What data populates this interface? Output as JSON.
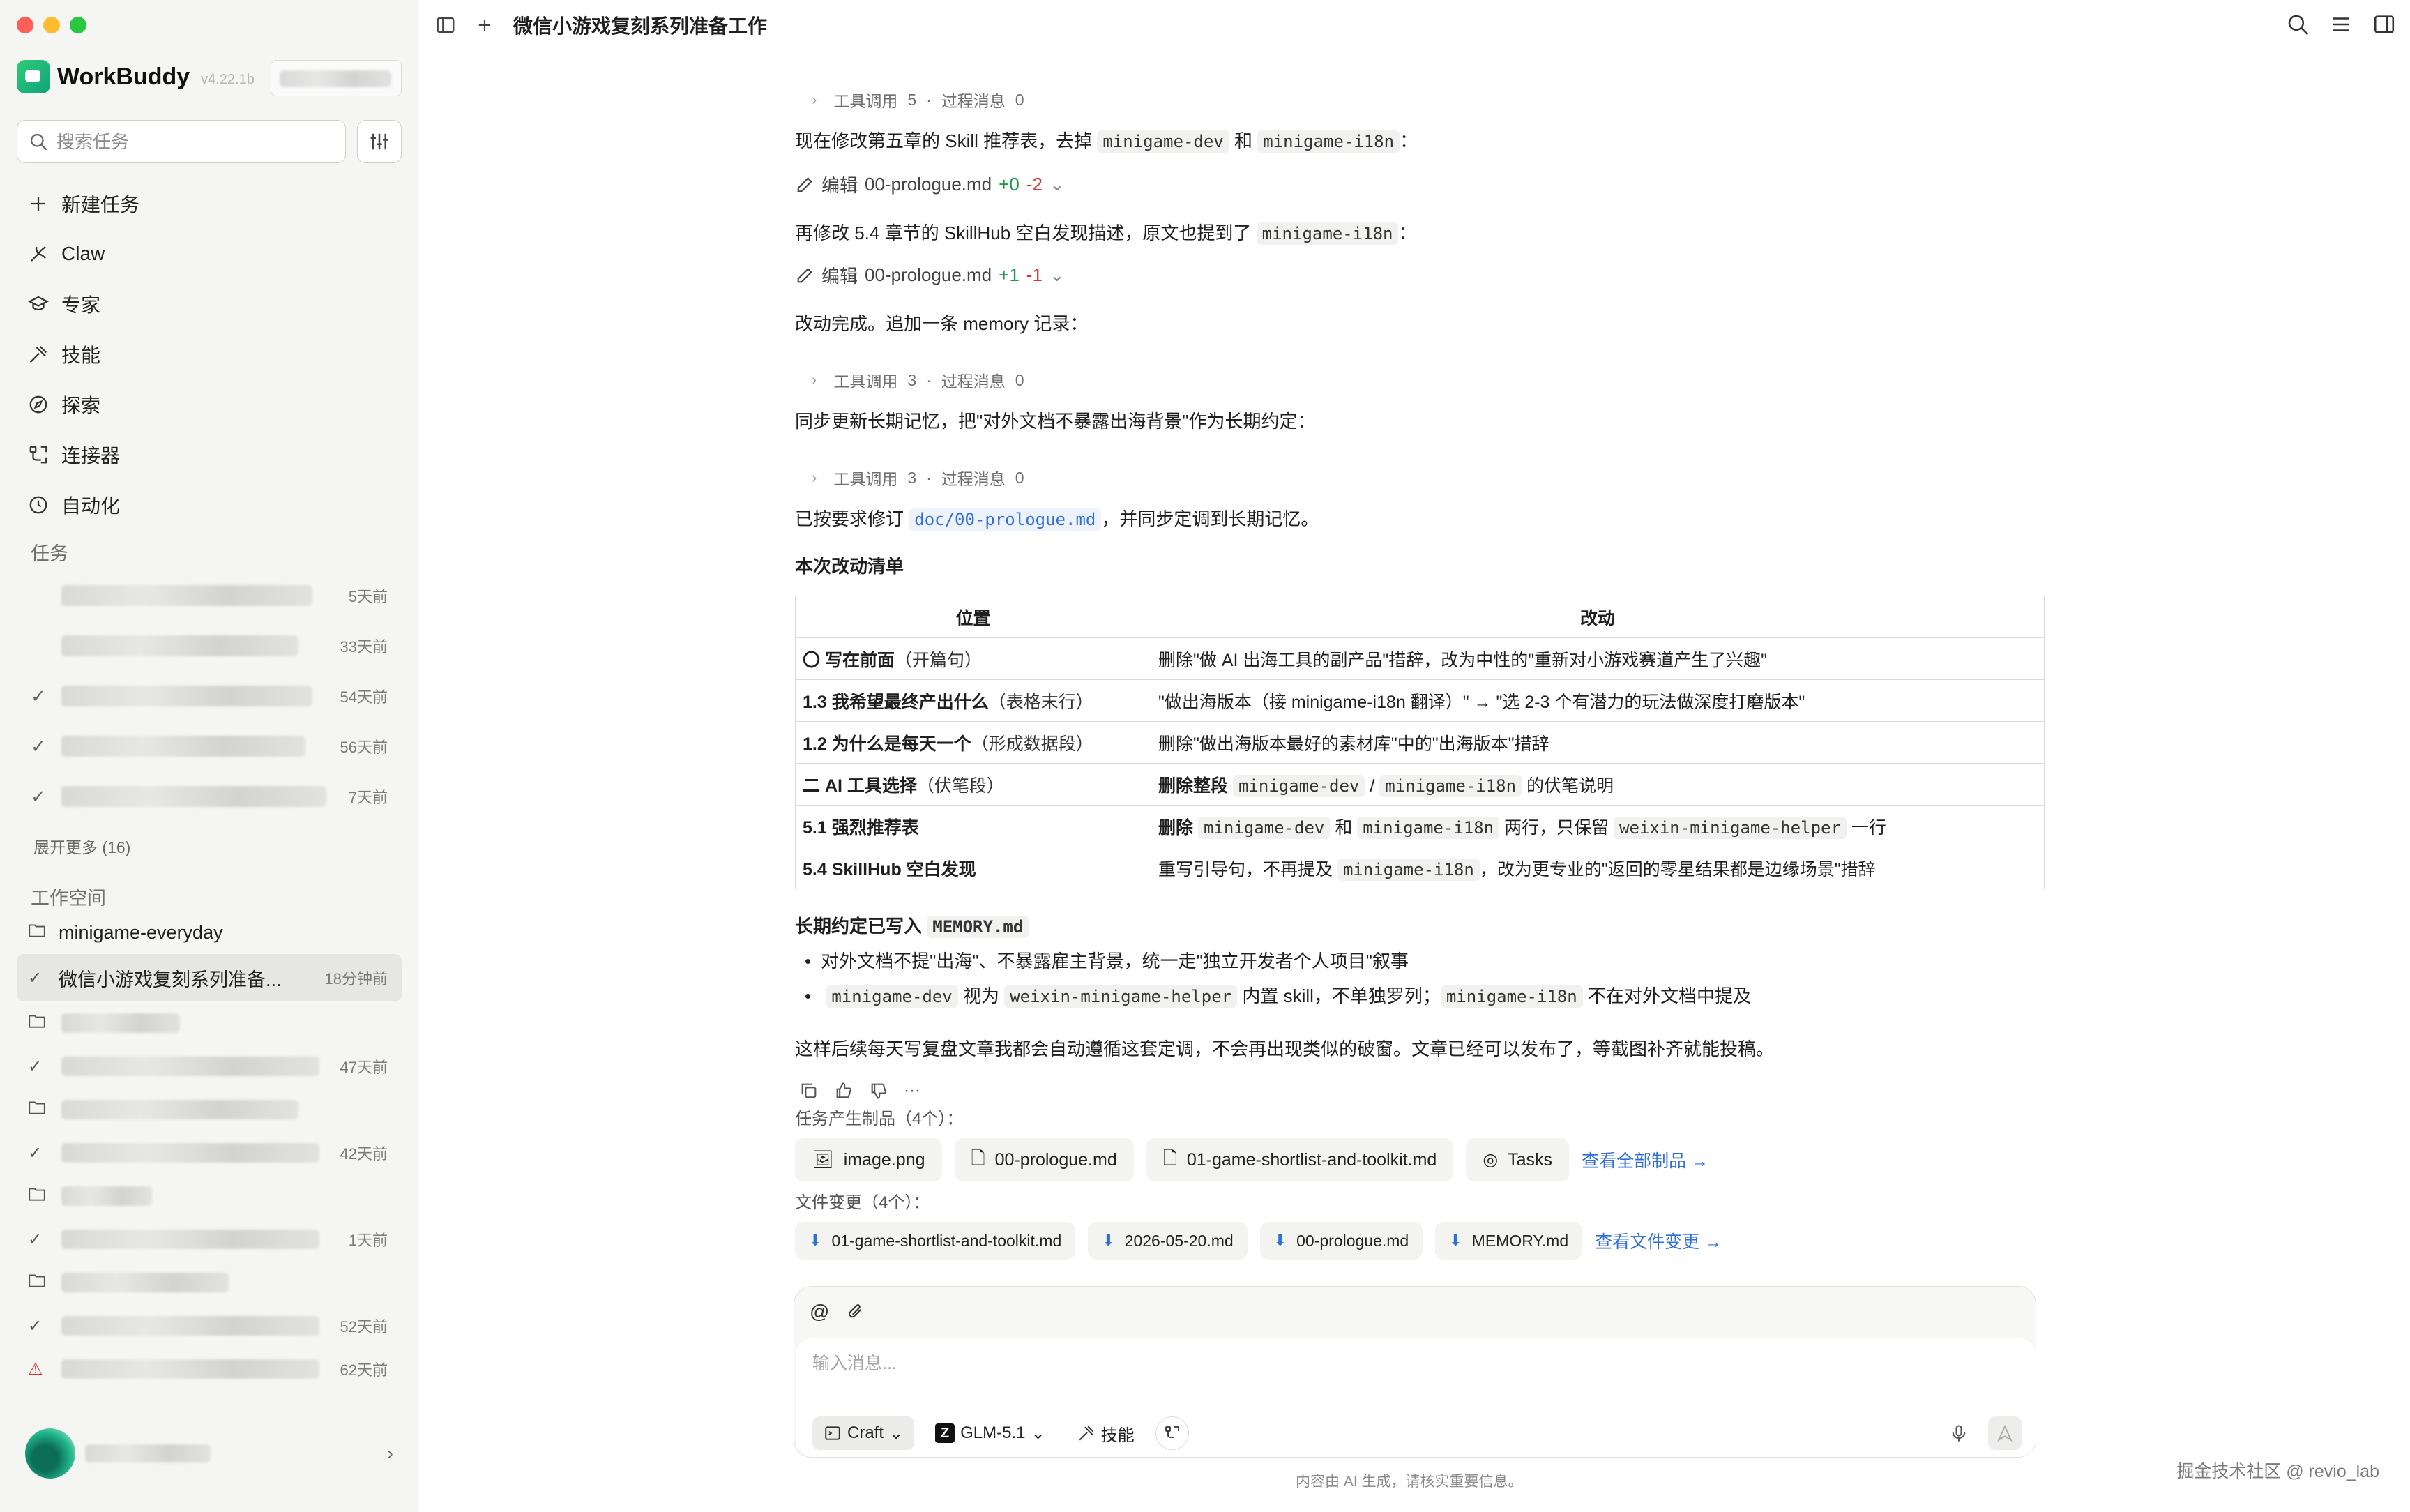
{
  "window": {
    "traffic_colors": [
      "#ff5f57",
      "#febc2e",
      "#28c840"
    ],
    "title": "微信小游戏复刻系列准备工作"
  },
  "sidebar": {
    "app_name": "WorkBuddy",
    "version": "v4.22.1b",
    "search_placeholder": "搜索任务",
    "nav": [
      {
        "label": "新建任务",
        "icon": "plus-icon"
      },
      {
        "label": "Claw",
        "icon": "claw-icon"
      },
      {
        "label": "专家",
        "icon": "graduation-cap-icon"
      },
      {
        "label": "技能",
        "icon": "skill-icon"
      },
      {
        "label": "探索",
        "icon": "compass-icon"
      },
      {
        "label": "连接器",
        "icon": "connector-icon"
      },
      {
        "label": "自动化",
        "icon": "clock-icon"
      }
    ],
    "tasks_label": "任务",
    "tasks": [
      {
        "time": "5天前",
        "checked": false
      },
      {
        "time": "33天前",
        "checked": false
      },
      {
        "time": "54天前",
        "checked": true
      },
      {
        "time": "56天前",
        "checked": true
      },
      {
        "time": "7天前",
        "checked": true
      }
    ],
    "expand_more": "展开更多 (16)",
    "workspace_label": "工作空间",
    "workspace_folder": "minigame-everyday",
    "active_task": {
      "label": "微信小游戏复刻系列准备...",
      "time": "18分钟前"
    },
    "workspace_rows": [
      {
        "type": "folder",
        "time": ""
      },
      {
        "type": "check",
        "time": "47天前"
      },
      {
        "type": "folder",
        "time": ""
      },
      {
        "type": "check",
        "time": "42天前"
      },
      {
        "type": "folder",
        "time": ""
      },
      {
        "type": "check",
        "time": "1天前"
      },
      {
        "type": "folder",
        "time": ""
      },
      {
        "type": "check",
        "time": "52天前"
      },
      {
        "type": "warning",
        "time": "62天前"
      }
    ]
  },
  "chat": {
    "tool_call_label": "工具调用",
    "process_label": "过程消息",
    "tool1": {
      "calls": "5",
      "process": "0"
    },
    "msg1_pre": "现在修改第五章的 Skill 推荐表，去掉",
    "msg1_code1": "minigame-dev",
    "msg1_mid": "和",
    "msg1_code2": "minigame-i18n",
    "msg1_post": "：",
    "edit_label": "编辑",
    "edit1": {
      "file": "00-prologue.md",
      "plus": "+0",
      "minus": "-2"
    },
    "msg2_pre": "再修改 5.4 章节的 SkillHub 空白发现描述，原文也提到了",
    "msg2_code": "minigame-i18n",
    "msg2_post": "：",
    "edit2": {
      "file": "00-prologue.md",
      "plus": "+1",
      "minus": "-1"
    },
    "msg3": "改动完成。追加一条 memory 记录：",
    "tool2": {
      "calls": "3",
      "process": "0"
    },
    "msg4": "同步更新长期记忆，把\"对外文档不暴露出海背景\"作为长期约定：",
    "tool3": {
      "calls": "3",
      "process": "0"
    },
    "msg5_pre": "已按要求修订",
    "msg5_code": "doc/00-prologue.md",
    "msg5_post": "，并同步定调到长期记忆。",
    "changes_title": "本次改动清单",
    "table_headers": [
      "位置",
      "改动"
    ],
    "rows": [
      {
        "pos_bold": "〇 写在前面",
        "pos_note": "（开篇句）",
        "change": "删除\"做 AI 出海工具的副产品\"措辞，改为中性的\"重新对小游戏赛道产生了兴趣\""
      },
      {
        "pos_bold": "1.3 我希望最终产出什么",
        "pos_note": "（表格末行）",
        "change": "\"做出海版本（接 minigame-i18n 翻译）\" → \"选 2-3 个有潜力的玩法做深度打磨版本\""
      },
      {
        "pos_bold": "1.2 为什么是每天一个",
        "pos_note": "（形成数据段）",
        "change": "删除\"做出海版本最好的素材库\"中的\"出海版本\"措辞"
      },
      {
        "pos_bold": "二 AI 工具选择",
        "pos_note": "（伏笔段）",
        "change_bold": "删除整段",
        "code1": "minigame-dev",
        "sep": "/",
        "code2": "minigame-i18n",
        "change_post": "的伏笔说明"
      },
      {
        "pos_bold": "5.1 强烈推荐表",
        "pos_note": "",
        "change_bold": "删除",
        "code1": "minigame-dev",
        "sep": "和",
        "code2": "minigame-i18n",
        "change_mid": "两行，只保留",
        "code3": "weixin-minigame-helper",
        "change_post": "一行"
      },
      {
        "pos_bold": "5.4 SkillHub 空白发现",
        "pos_note": "",
        "change_pre": "重写引导句，不再提及",
        "code1": "minigame-i18n",
        "change_post": "，改为更专业的\"返回的零星结果都是边缘场景\"措辞"
      }
    ],
    "memory_title_pre": "长期约定已写入",
    "memory_file": "MEMORY.md",
    "bullet1": "对外文档不提\"出海\"、不暴露雇主背景，统一走\"独立开发者个人项目\"叙事",
    "bullet2_code1": "minigame-dev",
    "bullet2_mid1": "视为",
    "bullet2_code2": "weixin-minigame-helper",
    "bullet2_mid2": "内置 skill，不单独罗列；",
    "bullet2_code3": "minigame-i18n",
    "bullet2_post": "不在对外文档中提及",
    "closing": "这样后续每天写复盘文章我都会自动遵循这套定调，不会再出现类似的破窗。文章已经可以发布了，等截图补齐就能投稿。",
    "artifacts_label": "任务产生制品（4个）：",
    "artifacts": [
      "image.png",
      "00-prologue.md",
      "01-game-shortlist-and-toolkit.md",
      "Tasks"
    ],
    "view_all_artifacts": "查看全部制品 →",
    "changes_label": "文件变更（4个）：",
    "file_changes": [
      "01-game-shortlist-and-toolkit.md",
      "2026-05-20.md",
      "00-prologue.md",
      "MEMORY.md"
    ],
    "view_file_changes": "查看文件变更 →"
  },
  "composer": {
    "placeholder": "输入消息...",
    "mode": "Craft",
    "model": "GLM-5.1",
    "skill_label": "技能"
  },
  "footer_note": "内容由 AI 生成，请核实重要信息。",
  "watermark": "掘金技术社区 @ revio_lab"
}
